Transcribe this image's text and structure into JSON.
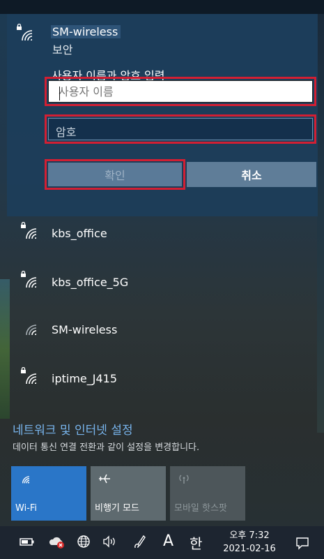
{
  "selected_network": {
    "name": "SM-wireless",
    "status": "보안",
    "prompt": "사용자 이름과 암호 입력",
    "username_placeholder": "사용자 이름",
    "password_placeholder": "암호",
    "ok_label": "확인",
    "cancel_label": "취소"
  },
  "networks": [
    {
      "name": "kbs_office",
      "icon": "wifi-secured-icon"
    },
    {
      "name": "kbs_office_5G",
      "icon": "wifi-secured-icon"
    },
    {
      "name": "SM-wireless",
      "icon": "wifi-icon"
    },
    {
      "name": "iptime_J415",
      "icon": "wifi-secured-icon"
    }
  ],
  "settings": {
    "link": "네트워크 및 인터넷 설정",
    "description": "데이터 통신 연결 전환과 같이 설정을 변경합니다."
  },
  "quick_actions": [
    {
      "label": "Wi-Fi",
      "icon": "wifi-icon",
      "active": true
    },
    {
      "label": "비행기 모드",
      "icon": "airplane-icon",
      "active": false
    },
    {
      "label": "모바일 핫스팟",
      "icon": "hotspot-icon",
      "active": false
    }
  ],
  "taskbar": {
    "ime_a": "A",
    "ime_han": "한",
    "time": "오후 7:32",
    "date": "2021-02-16"
  },
  "colors": {
    "accent": "#2a76c8",
    "highlight_border": "#d21f33",
    "link": "#78b4ec"
  }
}
